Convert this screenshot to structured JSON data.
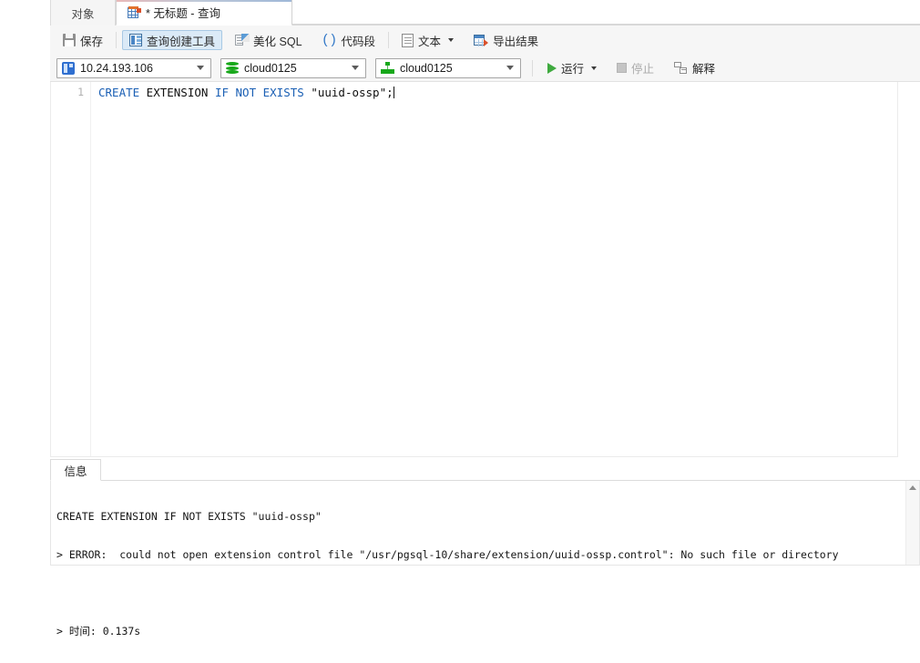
{
  "tabs": {
    "object": {
      "label": "对象",
      "icon": "object-tab"
    },
    "query": {
      "label": "* 无标题 - 查询",
      "icon": "query-grid-icon",
      "active": true
    }
  },
  "toolbar": {
    "save": {
      "label": "保存",
      "icon": "save-icon"
    },
    "query_builder": {
      "label": "查询创建工具",
      "icon": "query-builder-icon",
      "selected": true
    },
    "beautify_sql": {
      "label": "美化 SQL",
      "icon": "beautify-icon"
    },
    "code_snippet": {
      "label": "代码段",
      "icon": "parentheses-icon"
    },
    "text": {
      "label": "文本",
      "icon": "document-icon",
      "has_dropdown": true
    },
    "export_result": {
      "label": "导出结果",
      "icon": "export-icon"
    }
  },
  "connection_bar": {
    "host": {
      "value": "10.24.193.106",
      "icon": "server-icon"
    },
    "database": {
      "value": "cloud0125",
      "icon": "database-icon"
    },
    "schema": {
      "value": "cloud0125",
      "icon": "schema-icon"
    },
    "run": {
      "label": "运行",
      "icon": "play-icon",
      "has_dropdown": true
    },
    "stop": {
      "label": "停止",
      "icon": "stop-icon",
      "disabled": true
    },
    "explain": {
      "label": "解释",
      "icon": "explain-icon"
    }
  },
  "editor": {
    "line_number": "1",
    "sql_tokens": [
      {
        "text": "CREATE",
        "type": "keyword"
      },
      {
        "text": " ",
        "type": "plain"
      },
      {
        "text": "EXTENSION",
        "type": "plain"
      },
      {
        "text": " ",
        "type": "plain"
      },
      {
        "text": "IF",
        "type": "keyword"
      },
      {
        "text": " ",
        "type": "plain"
      },
      {
        "text": "NOT",
        "type": "keyword"
      },
      {
        "text": " ",
        "type": "plain"
      },
      {
        "text": "EXISTS",
        "type": "keyword"
      },
      {
        "text": " ",
        "type": "plain"
      },
      {
        "text": "\"uuid-ossp\";",
        "type": "plain"
      }
    ],
    "full_sql": "CREATE EXTENSION IF NOT EXISTS \"uuid-ossp\";",
    "seg_create": "CREATE",
    "seg_extension": " EXTENSION ",
    "seg_ifnotexists": "IF NOT EXISTS",
    "seg_literal": " \"uuid-ossp\";"
  },
  "info_panel": {
    "tab_label": "信息",
    "log_line_1": "CREATE EXTENSION IF NOT EXISTS \"uuid-ossp\"",
    "log_line_2": "> ERROR:  could not open extension control file \"/usr/pgsql-10/share/extension/uuid-ossp.control\": No such file or directory",
    "log_line_3": "> 时间: 0.137s"
  },
  "colors": {
    "keyword": "#1a5fb4",
    "run_green": "#3faa3f",
    "accent_blue": "#4a86c5",
    "toolbar_bg": "#f6f6f6",
    "selected_btn": "#dbeaf7"
  }
}
